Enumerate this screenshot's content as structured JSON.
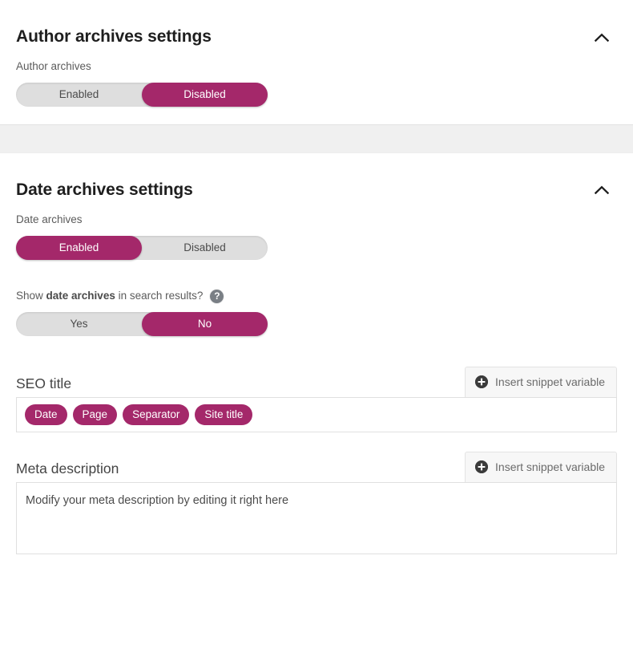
{
  "accent_color": "#a4286a",
  "sections": [
    {
      "title": "Author archives settings",
      "collapse_icon": "chevron-up-icon",
      "field_label": "Author archives",
      "toggle": {
        "options": [
          "Enabled",
          "Disabled"
        ],
        "selected": "Disabled"
      }
    },
    {
      "title": "Date archives settings",
      "collapse_icon": "chevron-up-icon",
      "field_label": "Date archives",
      "toggle": {
        "options": [
          "Enabled",
          "Disabled"
        ],
        "selected": "Enabled"
      }
    }
  ],
  "search_results_setting": {
    "label_prefix": "Show ",
    "label_strong": "date archives",
    "label_suffix": " in search results?",
    "help_icon": "help-circle-icon",
    "help_glyph": "?",
    "toggle": {
      "options": [
        "Yes",
        "No"
      ],
      "selected": "No"
    }
  },
  "seo_title": {
    "label": "SEO title",
    "insert_button": {
      "label": "Insert snippet variable",
      "icon": "plus-circle-icon"
    },
    "chips": [
      "Date",
      "Page",
      "Separator",
      "Site title"
    ]
  },
  "meta_description": {
    "label": "Meta description",
    "insert_button": {
      "label": "Insert snippet variable",
      "icon": "plus-circle-icon"
    },
    "value": "Modify your meta description by editing it right here"
  }
}
